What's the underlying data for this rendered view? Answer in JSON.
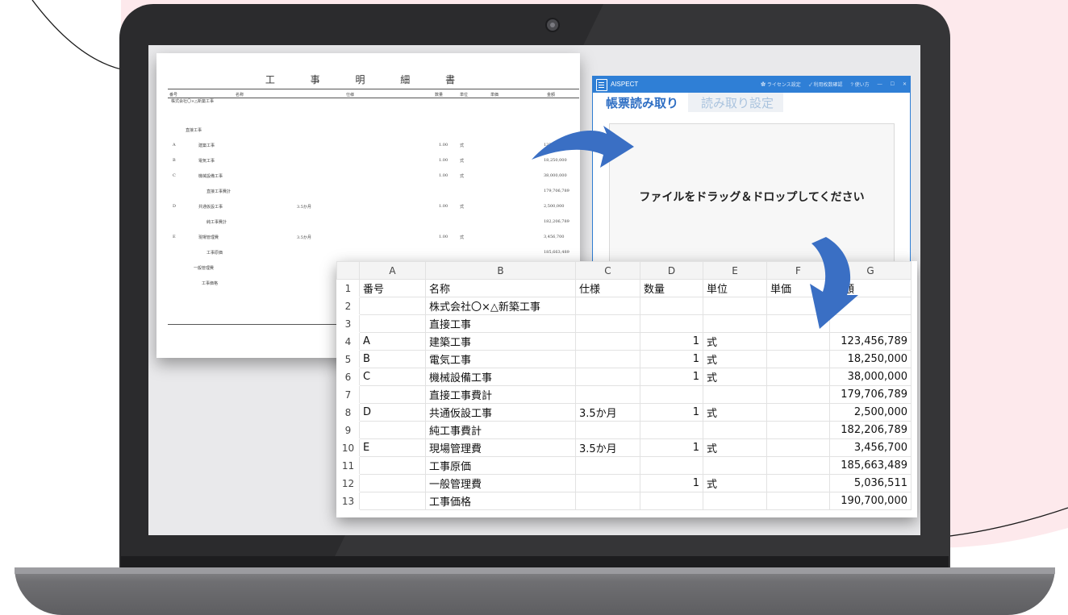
{
  "paper": {
    "title": "工 事 明 細 書",
    "headers": [
      "番号",
      "名称",
      "仕様",
      "数量",
      "単位",
      "単価",
      "金額"
    ],
    "company_line": "株式会社〇×△新築工事",
    "rows": [
      {
        "no": "",
        "name": "直接工事",
        "spec": "",
        "qty": "",
        "unit": "",
        "amount": ""
      },
      {
        "no": "A",
        "name": "建築工事",
        "spec": "",
        "qty": "1.00",
        "unit": "式",
        "amount": "123,"
      },
      {
        "no": "B",
        "name": "電気工事",
        "spec": "",
        "qty": "1.00",
        "unit": "式",
        "amount": "18,250,000"
      },
      {
        "no": "C",
        "name": "機械設備工事",
        "spec": "",
        "qty": "1.00",
        "unit": "式",
        "amount": "38,000,000"
      },
      {
        "no": "",
        "name": "直接工事費計",
        "spec": "",
        "qty": "",
        "unit": "",
        "amount": "179,706,789"
      },
      {
        "no": "D",
        "name": "共通仮設工事",
        "spec": "3.5か月",
        "qty": "1.00",
        "unit": "式",
        "amount": "2,500,000"
      },
      {
        "no": "",
        "name": "純工事費計",
        "spec": "",
        "qty": "",
        "unit": "",
        "amount": "182,206,789"
      },
      {
        "no": "E",
        "name": "現場管理費",
        "spec": "3.5か月",
        "qty": "1.00",
        "unit": "式",
        "amount": "3,456,700"
      },
      {
        "no": "",
        "name": "工事原価",
        "spec": "",
        "qty": "",
        "unit": "",
        "amount": "185,663,489"
      },
      {
        "no": "",
        "name": "一般管理費",
        "spec": "",
        "qty": "",
        "unit": "",
        "amount": ""
      },
      {
        "no": "",
        "name": "工事価格",
        "spec": "",
        "qty": "",
        "unit": "",
        "amount": ""
      }
    ]
  },
  "app": {
    "title": "AISPECT",
    "menu": {
      "license": "ライセンス設定",
      "usage": "利用枚数確認",
      "help": "使い方"
    },
    "window_controls": {
      "minimize": "—",
      "maximize": "☐",
      "close": "✕"
    },
    "tabs": [
      {
        "label": "帳票読み取り",
        "active": true
      },
      {
        "label": "読み取り設定",
        "active": false
      }
    ],
    "drop_text": "ファイルをドラッグ＆ドロップしてください"
  },
  "sheet": {
    "columns": [
      "A",
      "B",
      "C",
      "D",
      "E",
      "F",
      "G"
    ],
    "rows": [
      {
        "n": "1",
        "cells": [
          "番号",
          "名称",
          "仕様",
          "数量",
          "単位",
          "単価",
          "金額"
        ]
      },
      {
        "n": "2",
        "cells": [
          "",
          "株式会社〇×△新築工事",
          "",
          "",
          "",
          "",
          ""
        ]
      },
      {
        "n": "3",
        "cells": [
          "",
          "直接工事",
          "",
          "",
          "",
          "",
          ""
        ]
      },
      {
        "n": "4",
        "cells": [
          "A",
          "建築工事",
          "",
          "1",
          "式",
          "",
          "123,456,789"
        ]
      },
      {
        "n": "5",
        "cells": [
          "B",
          "電気工事",
          "",
          "1",
          "式",
          "",
          "18,250,000"
        ]
      },
      {
        "n": "6",
        "cells": [
          "C",
          "機械設備工事",
          "",
          "1",
          "式",
          "",
          "38,000,000"
        ]
      },
      {
        "n": "7",
        "cells": [
          "",
          "直接工事費計",
          "",
          "",
          "",
          "",
          "179,706,789"
        ]
      },
      {
        "n": "8",
        "cells": [
          "D",
          "共通仮設工事",
          "3.5か月",
          "1",
          "式",
          "",
          "2,500,000"
        ]
      },
      {
        "n": "9",
        "cells": [
          "",
          "純工事費計",
          "",
          "",
          "",
          "",
          "182,206,789"
        ]
      },
      {
        "n": "10",
        "cells": [
          "E",
          "現場管理費",
          "3.5か月",
          "1",
          "式",
          "",
          "3,456,700"
        ]
      },
      {
        "n": "11",
        "cells": [
          "",
          "工事原価",
          "",
          "",
          "",
          "",
          "185,663,489"
        ]
      },
      {
        "n": "12",
        "cells": [
          "",
          "一般管理費",
          "",
          "1",
          "式",
          "",
          "5,036,511"
        ]
      },
      {
        "n": "13",
        "cells": [
          "",
          "工事価格",
          "",
          "",
          "",
          "",
          "190,700,000"
        ]
      }
    ]
  },
  "colors": {
    "accent_blue": "#2f7fd6",
    "arrow_blue": "#3a6fc4",
    "background_pink": "#fde9ec",
    "laptop_body": "#2b2b2d"
  }
}
